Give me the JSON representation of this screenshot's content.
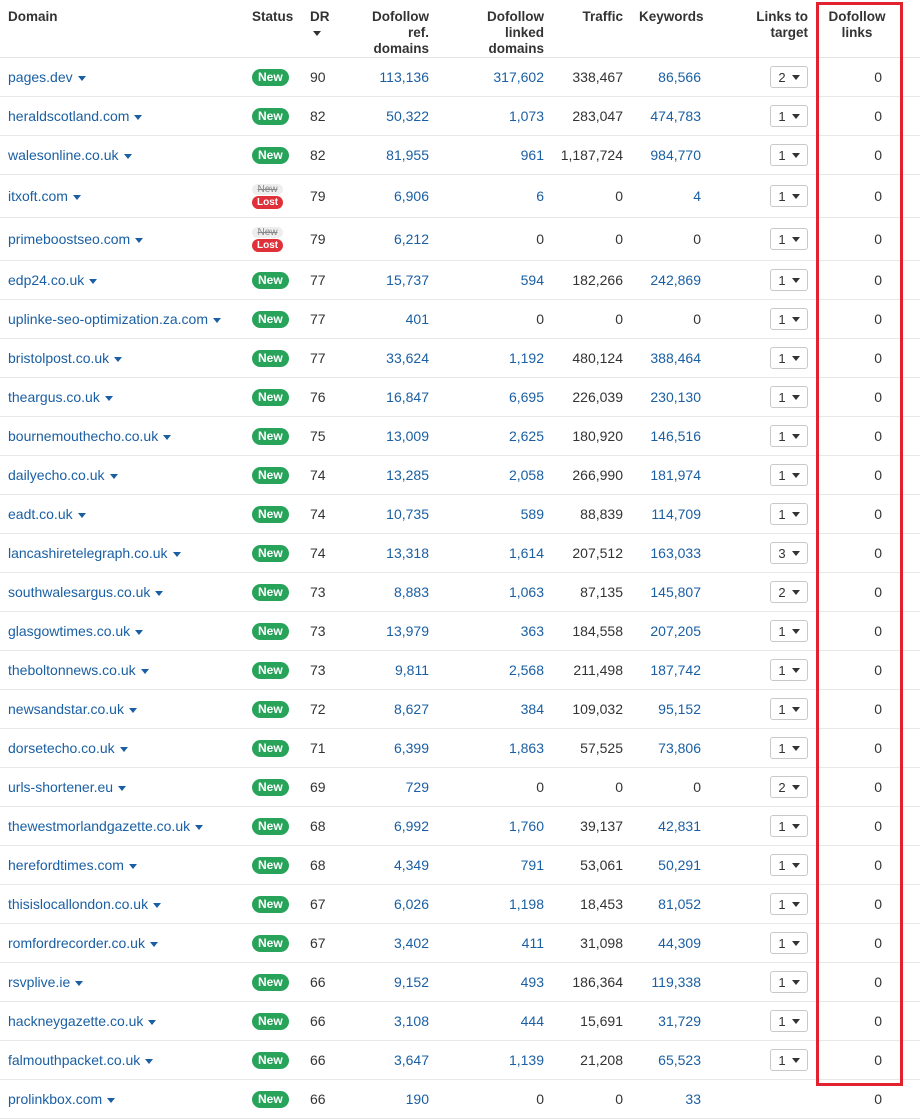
{
  "headers": {
    "domain": "Domain",
    "status": "Status",
    "dr": "DR",
    "ref_domains_1": "Dofollow ref.",
    "ref_domains_2": "domains",
    "linked_1": "Dofollow linked",
    "linked_2": "domains",
    "traffic": "Traffic",
    "keywords": "Keywords",
    "links_to_target": "Links to target",
    "dofollow_links_1": "Dofollow",
    "dofollow_links_2": "links"
  },
  "rows": [
    {
      "domain": "pages.dev",
      "status": "New",
      "dr": "90",
      "ref": "113,136",
      "linked": "317,602",
      "traffic": "338,467",
      "keywords": "86,566",
      "links": "2",
      "dofollow": "0"
    },
    {
      "domain": "heraldscotland.com",
      "status": "New",
      "dr": "82",
      "ref": "50,322",
      "linked": "1,073",
      "traffic": "283,047",
      "keywords": "474,783",
      "links": "1",
      "dofollow": "0"
    },
    {
      "domain": "walesonline.co.uk",
      "status": "New",
      "dr": "82",
      "ref": "81,955",
      "linked": "961",
      "traffic": "1,187,724",
      "keywords": "984,770",
      "links": "1",
      "dofollow": "0"
    },
    {
      "domain": "itxoft.com",
      "status": "Lost",
      "status_old": "New",
      "dr": "79",
      "ref": "6,906",
      "linked": "6",
      "traffic": "0",
      "keywords": "4",
      "links": "1",
      "dofollow": "0"
    },
    {
      "domain": "primeboostseo.com",
      "status": "Lost",
      "status_old": "New",
      "dr": "79",
      "ref": "6,212",
      "linked": "0",
      "traffic": "0",
      "keywords": "0",
      "links": "1",
      "dofollow": "0"
    },
    {
      "domain": "edp24.co.uk",
      "status": "New",
      "dr": "77",
      "ref": "15,737",
      "linked": "594",
      "traffic": "182,266",
      "keywords": "242,869",
      "links": "1",
      "dofollow": "0"
    },
    {
      "domain": "uplinke-seo-optimization.za.com",
      "status": "New",
      "dr": "77",
      "ref": "401",
      "linked": "0",
      "traffic": "0",
      "keywords": "0",
      "links": "1",
      "dofollow": "0"
    },
    {
      "domain": "bristolpost.co.uk",
      "status": "New",
      "dr": "77",
      "ref": "33,624",
      "linked": "1,192",
      "traffic": "480,124",
      "keywords": "388,464",
      "links": "1",
      "dofollow": "0"
    },
    {
      "domain": "theargus.co.uk",
      "status": "New",
      "dr": "76",
      "ref": "16,847",
      "linked": "6,695",
      "traffic": "226,039",
      "keywords": "230,130",
      "links": "1",
      "dofollow": "0"
    },
    {
      "domain": "bournemouthecho.co.uk",
      "status": "New",
      "dr": "75",
      "ref": "13,009",
      "linked": "2,625",
      "traffic": "180,920",
      "keywords": "146,516",
      "links": "1",
      "dofollow": "0"
    },
    {
      "domain": "dailyecho.co.uk",
      "status": "New",
      "dr": "74",
      "ref": "13,285",
      "linked": "2,058",
      "traffic": "266,990",
      "keywords": "181,974",
      "links": "1",
      "dofollow": "0"
    },
    {
      "domain": "eadt.co.uk",
      "status": "New",
      "dr": "74",
      "ref": "10,735",
      "linked": "589",
      "traffic": "88,839",
      "keywords": "114,709",
      "links": "1",
      "dofollow": "0"
    },
    {
      "domain": "lancashiretelegraph.co.uk",
      "status": "New",
      "dr": "74",
      "ref": "13,318",
      "linked": "1,614",
      "traffic": "207,512",
      "keywords": "163,033",
      "links": "3",
      "dofollow": "0"
    },
    {
      "domain": "southwalesargus.co.uk",
      "status": "New",
      "dr": "73",
      "ref": "8,883",
      "linked": "1,063",
      "traffic": "87,135",
      "keywords": "145,807",
      "links": "2",
      "dofollow": "0"
    },
    {
      "domain": "glasgowtimes.co.uk",
      "status": "New",
      "dr": "73",
      "ref": "13,979",
      "linked": "363",
      "traffic": "184,558",
      "keywords": "207,205",
      "links": "1",
      "dofollow": "0"
    },
    {
      "domain": "theboltonnews.co.uk",
      "status": "New",
      "dr": "73",
      "ref": "9,811",
      "linked": "2,568",
      "traffic": "211,498",
      "keywords": "187,742",
      "links": "1",
      "dofollow": "0"
    },
    {
      "domain": "newsandstar.co.uk",
      "status": "New",
      "dr": "72",
      "ref": "8,627",
      "linked": "384",
      "traffic": "109,032",
      "keywords": "95,152",
      "links": "1",
      "dofollow": "0"
    },
    {
      "domain": "dorsetecho.co.uk",
      "status": "New",
      "dr": "71",
      "ref": "6,399",
      "linked": "1,863",
      "traffic": "57,525",
      "keywords": "73,806",
      "links": "1",
      "dofollow": "0"
    },
    {
      "domain": "urls-shortener.eu",
      "status": "New",
      "dr": "69",
      "ref": "729",
      "linked": "0",
      "traffic": "0",
      "keywords": "0",
      "links": "2",
      "dofollow": "0"
    },
    {
      "domain": "thewestmorlandgazette.co.uk",
      "status": "New",
      "dr": "68",
      "ref": "6,992",
      "linked": "1,760",
      "traffic": "39,137",
      "keywords": "42,831",
      "links": "1",
      "dofollow": "0"
    },
    {
      "domain": "herefordtimes.com",
      "status": "New",
      "dr": "68",
      "ref": "4,349",
      "linked": "791",
      "traffic": "53,061",
      "keywords": "50,291",
      "links": "1",
      "dofollow": "0"
    },
    {
      "domain": "thisislocallondon.co.uk",
      "status": "New",
      "dr": "67",
      "ref": "6,026",
      "linked": "1,198",
      "traffic": "18,453",
      "keywords": "81,052",
      "links": "1",
      "dofollow": "0"
    },
    {
      "domain": "romfordrecorder.co.uk",
      "status": "New",
      "dr": "67",
      "ref": "3,402",
      "linked": "411",
      "traffic": "31,098",
      "keywords": "44,309",
      "links": "1",
      "dofollow": "0"
    },
    {
      "domain": "rsvplive.ie",
      "status": "New",
      "dr": "66",
      "ref": "9,152",
      "linked": "493",
      "traffic": "186,364",
      "keywords": "119,338",
      "links": "1",
      "dofollow": "0"
    },
    {
      "domain": "hackneygazette.co.uk",
      "status": "New",
      "dr": "66",
      "ref": "3,108",
      "linked": "444",
      "traffic": "15,691",
      "keywords": "31,729",
      "links": "1",
      "dofollow": "0"
    },
    {
      "domain": "falmouthpacket.co.uk",
      "status": "New",
      "dr": "66",
      "ref": "3,647",
      "linked": "1,139",
      "traffic": "21,208",
      "keywords": "65,523",
      "links": "1",
      "dofollow": "0"
    },
    {
      "domain": "prolinkbox.com",
      "status": "New",
      "dr": "66",
      "ref": "190",
      "linked": "0",
      "traffic": "0",
      "keywords": "33",
      "links": "",
      "dofollow": "0"
    }
  ],
  "colors": {
    "link": "#1a5fa3",
    "new_badge": "#27a35a",
    "lost_badge": "#e0313a",
    "highlight": "#e32230"
  }
}
